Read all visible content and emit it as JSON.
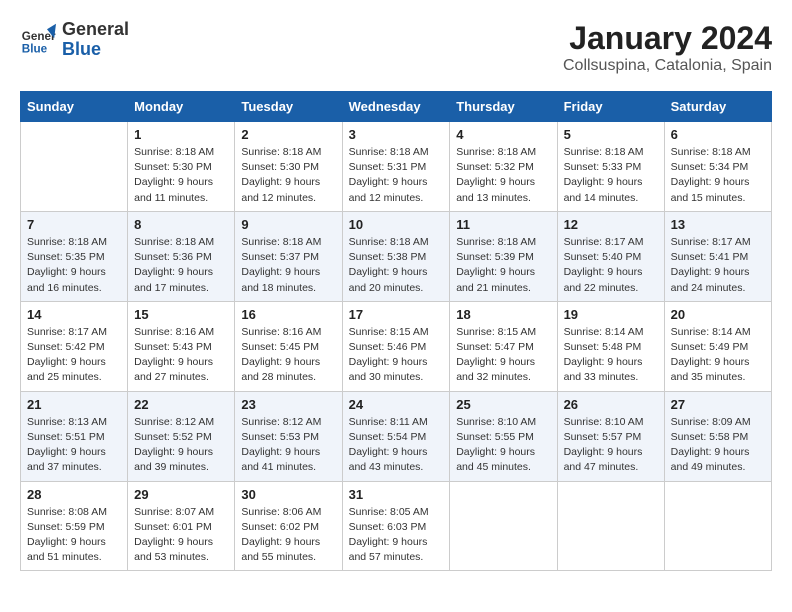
{
  "logo": {
    "text_general": "General",
    "text_blue": "Blue"
  },
  "title": "January 2024",
  "subtitle": "Collsuspina, Catalonia, Spain",
  "days_of_week": [
    "Sunday",
    "Monday",
    "Tuesday",
    "Wednesday",
    "Thursday",
    "Friday",
    "Saturday"
  ],
  "weeks": [
    [
      {
        "day": "",
        "info": ""
      },
      {
        "day": "1",
        "info": "Sunrise: 8:18 AM\nSunset: 5:30 PM\nDaylight: 9 hours\nand 11 minutes."
      },
      {
        "day": "2",
        "info": "Sunrise: 8:18 AM\nSunset: 5:30 PM\nDaylight: 9 hours\nand 12 minutes."
      },
      {
        "day": "3",
        "info": "Sunrise: 8:18 AM\nSunset: 5:31 PM\nDaylight: 9 hours\nand 12 minutes."
      },
      {
        "day": "4",
        "info": "Sunrise: 8:18 AM\nSunset: 5:32 PM\nDaylight: 9 hours\nand 13 minutes."
      },
      {
        "day": "5",
        "info": "Sunrise: 8:18 AM\nSunset: 5:33 PM\nDaylight: 9 hours\nand 14 minutes."
      },
      {
        "day": "6",
        "info": "Sunrise: 8:18 AM\nSunset: 5:34 PM\nDaylight: 9 hours\nand 15 minutes."
      }
    ],
    [
      {
        "day": "7",
        "info": "Sunrise: 8:18 AM\nSunset: 5:35 PM\nDaylight: 9 hours\nand 16 minutes."
      },
      {
        "day": "8",
        "info": "Sunrise: 8:18 AM\nSunset: 5:36 PM\nDaylight: 9 hours\nand 17 minutes."
      },
      {
        "day": "9",
        "info": "Sunrise: 8:18 AM\nSunset: 5:37 PM\nDaylight: 9 hours\nand 18 minutes."
      },
      {
        "day": "10",
        "info": "Sunrise: 8:18 AM\nSunset: 5:38 PM\nDaylight: 9 hours\nand 20 minutes."
      },
      {
        "day": "11",
        "info": "Sunrise: 8:18 AM\nSunset: 5:39 PM\nDaylight: 9 hours\nand 21 minutes."
      },
      {
        "day": "12",
        "info": "Sunrise: 8:17 AM\nSunset: 5:40 PM\nDaylight: 9 hours\nand 22 minutes."
      },
      {
        "day": "13",
        "info": "Sunrise: 8:17 AM\nSunset: 5:41 PM\nDaylight: 9 hours\nand 24 minutes."
      }
    ],
    [
      {
        "day": "14",
        "info": "Sunrise: 8:17 AM\nSunset: 5:42 PM\nDaylight: 9 hours\nand 25 minutes."
      },
      {
        "day": "15",
        "info": "Sunrise: 8:16 AM\nSunset: 5:43 PM\nDaylight: 9 hours\nand 27 minutes."
      },
      {
        "day": "16",
        "info": "Sunrise: 8:16 AM\nSunset: 5:45 PM\nDaylight: 9 hours\nand 28 minutes."
      },
      {
        "day": "17",
        "info": "Sunrise: 8:15 AM\nSunset: 5:46 PM\nDaylight: 9 hours\nand 30 minutes."
      },
      {
        "day": "18",
        "info": "Sunrise: 8:15 AM\nSunset: 5:47 PM\nDaylight: 9 hours\nand 32 minutes."
      },
      {
        "day": "19",
        "info": "Sunrise: 8:14 AM\nSunset: 5:48 PM\nDaylight: 9 hours\nand 33 minutes."
      },
      {
        "day": "20",
        "info": "Sunrise: 8:14 AM\nSunset: 5:49 PM\nDaylight: 9 hours\nand 35 minutes."
      }
    ],
    [
      {
        "day": "21",
        "info": "Sunrise: 8:13 AM\nSunset: 5:51 PM\nDaylight: 9 hours\nand 37 minutes."
      },
      {
        "day": "22",
        "info": "Sunrise: 8:12 AM\nSunset: 5:52 PM\nDaylight: 9 hours\nand 39 minutes."
      },
      {
        "day": "23",
        "info": "Sunrise: 8:12 AM\nSunset: 5:53 PM\nDaylight: 9 hours\nand 41 minutes."
      },
      {
        "day": "24",
        "info": "Sunrise: 8:11 AM\nSunset: 5:54 PM\nDaylight: 9 hours\nand 43 minutes."
      },
      {
        "day": "25",
        "info": "Sunrise: 8:10 AM\nSunset: 5:55 PM\nDaylight: 9 hours\nand 45 minutes."
      },
      {
        "day": "26",
        "info": "Sunrise: 8:10 AM\nSunset: 5:57 PM\nDaylight: 9 hours\nand 47 minutes."
      },
      {
        "day": "27",
        "info": "Sunrise: 8:09 AM\nSunset: 5:58 PM\nDaylight: 9 hours\nand 49 minutes."
      }
    ],
    [
      {
        "day": "28",
        "info": "Sunrise: 8:08 AM\nSunset: 5:59 PM\nDaylight: 9 hours\nand 51 minutes."
      },
      {
        "day": "29",
        "info": "Sunrise: 8:07 AM\nSunset: 6:01 PM\nDaylight: 9 hours\nand 53 minutes."
      },
      {
        "day": "30",
        "info": "Sunrise: 8:06 AM\nSunset: 6:02 PM\nDaylight: 9 hours\nand 55 minutes."
      },
      {
        "day": "31",
        "info": "Sunrise: 8:05 AM\nSunset: 6:03 PM\nDaylight: 9 hours\nand 57 minutes."
      },
      {
        "day": "",
        "info": ""
      },
      {
        "day": "",
        "info": ""
      },
      {
        "day": "",
        "info": ""
      }
    ]
  ]
}
